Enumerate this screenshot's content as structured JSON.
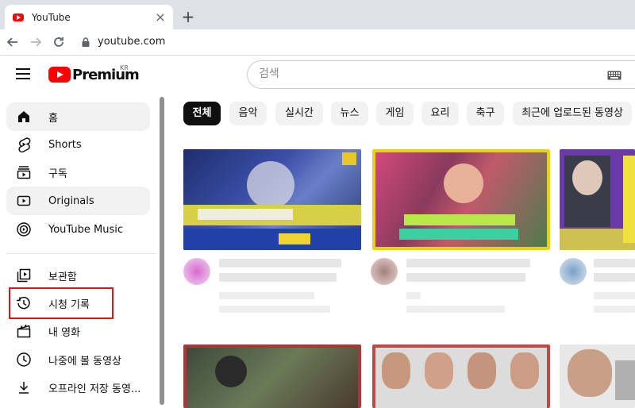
{
  "browser": {
    "tab_title": "YouTube",
    "url": "youtube.com",
    "close_glyph": "×",
    "newtab_glyph": "+"
  },
  "header": {
    "logo_text": "Premium",
    "region": "KR",
    "search_placeholder": "검색"
  },
  "sidebar": {
    "items": [
      {
        "label": "홈",
        "icon": "home-icon"
      },
      {
        "label": "Shorts",
        "icon": "shorts-icon"
      },
      {
        "label": "구독",
        "icon": "subscriptions-icon"
      },
      {
        "label": "Originals",
        "icon": "originals-icon"
      },
      {
        "label": "YouTube Music",
        "icon": "youtube-music-icon"
      },
      {
        "label": "보관함",
        "icon": "library-icon"
      },
      {
        "label": "시청 기록",
        "icon": "history-icon"
      },
      {
        "label": "내 영화",
        "icon": "my-movies-icon"
      },
      {
        "label": "나중에 볼 동영상",
        "icon": "watch-later-icon"
      },
      {
        "label": "오프라인 저장 동영...",
        "icon": "download-icon"
      }
    ]
  },
  "chips": [
    "전체",
    "음악",
    "실시간",
    "뉴스",
    "게임",
    "요리",
    "축구",
    "최근에 업로드된 동영상"
  ],
  "colors": {
    "brand": "#ff0000",
    "annotation": "#e0151a"
  }
}
